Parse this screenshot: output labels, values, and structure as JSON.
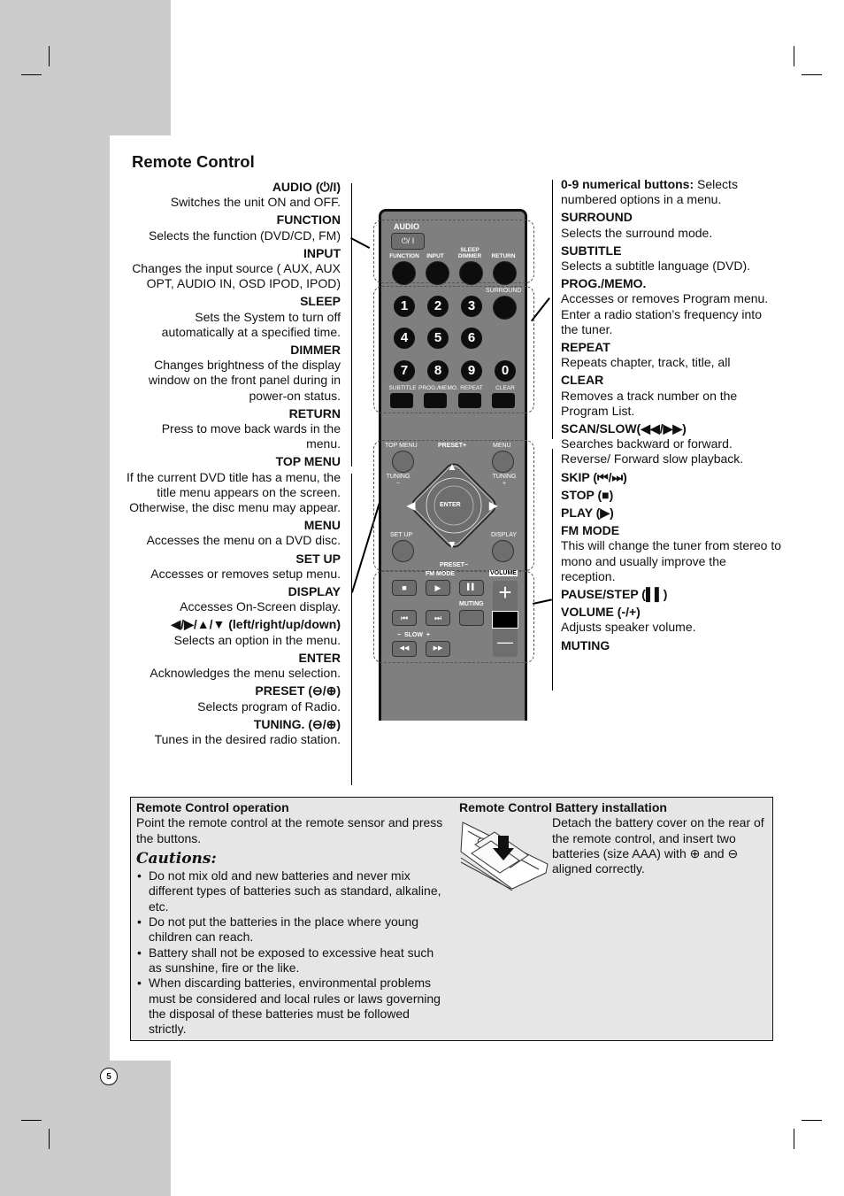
{
  "page": {
    "title": "Remote Control",
    "page_number": "5"
  },
  "left_descriptions": [
    {
      "heading": "AUDIO (⏻/I)",
      "text": "Switches the unit ON and OFF."
    },
    {
      "heading": "FUNCTION",
      "text": "Selects the function (DVD/CD, FM)"
    },
    {
      "heading": "INPUT",
      "text": "Changes the input source ( AUX, AUX OPT, AUDIO IN, OSD IPOD, IPOD)"
    },
    {
      "heading": "SLEEP",
      "text": "Sets the System to turn off automatically at a specified time."
    },
    {
      "heading": "DIMMER",
      "text": "Changes brightness of the display window on the front panel during in power-on status."
    },
    {
      "heading": "RETURN",
      "text": "Press to move back wards in the menu."
    },
    {
      "heading": "TOP MENU",
      "text": "If the current DVD title has a menu, the title menu appears on the screen. Otherwise, the disc menu may appear."
    },
    {
      "heading": "MENU",
      "text": "Accesses the menu on a DVD disc."
    },
    {
      "heading": "SET UP",
      "text": "Accesses or removes setup menu."
    },
    {
      "heading": "DISPLAY",
      "text": "Accesses On-Screen display."
    },
    {
      "heading": "◀/▶/▲/▼ (left/right/up/down)",
      "text": "Selects an option in the menu."
    },
    {
      "heading": "ENTER",
      "text": "Acknowledges the menu selection."
    },
    {
      "heading": "PRESET (⊖/⊕)",
      "text": "Selects program of Radio."
    },
    {
      "heading": "TUNING. (⊖/⊕)",
      "text": "Tunes in the desired radio station."
    }
  ],
  "right_descriptions": [
    {
      "heading": "0-9 numerical buttons:",
      "text": " Selects numbered options in a menu.",
      "inline": true
    },
    {
      "heading": "SURROUND",
      "text": "Selects the surround mode."
    },
    {
      "heading": "SUBTITLE",
      "text": "Selects a subtitle language (DVD)."
    },
    {
      "heading": "PROG./MEMO.",
      "text": "Accesses or removes Program menu.\nEnter a radio station’s frequency into the tuner."
    },
    {
      "heading": "REPEAT",
      "text": "Repeats chapter, track, title, all"
    },
    {
      "heading": "CLEAR",
      "text": "Removes a track number on the Program List."
    },
    {
      "heading": "SCAN/SLOW(◀◀/▶▶)",
      "text": "Searches backward or forward. Reverse/ Forward slow playback."
    },
    {
      "heading": "SKIP (⏮/⏭)",
      "text": ""
    },
    {
      "heading": "STOP (■)",
      "text": ""
    },
    {
      "heading": "PLAY (▶)",
      "text": ""
    },
    {
      "heading": "FM MODE",
      "text": "This will change the tuner from stereo to mono and usually improve the reception."
    },
    {
      "heading": "PAUSE/STEP (▌▌)",
      "text": ""
    },
    {
      "heading": "VOLUME (-/+)",
      "text": "Adjusts speaker volume."
    },
    {
      "heading": "MUTING",
      "text": ""
    }
  ],
  "remote": {
    "audio_label": "AUDIO",
    "power_glyph": "⏻/ I",
    "top_row_labels": [
      "FUNCTION",
      "INPUT",
      "SLEEP DIMMER",
      "RETURN"
    ],
    "surround_label": "SURROUND",
    "digits": [
      "1",
      "2",
      "3",
      "4",
      "5",
      "6",
      "7",
      "8",
      "9",
      "0"
    ],
    "bottom_row_labels": [
      "SUBTITLE",
      "PROG./MEMO.",
      "REPEAT",
      "CLEAR"
    ],
    "top_menu": "TOP MENU",
    "preset_plus": "PRESET+",
    "menu": "MENU",
    "tuning_minus": "TUNING −",
    "tuning_plus": "TUNING +",
    "enter": "ENTER",
    "set_up": "SET UP",
    "display": "DISPLAY",
    "preset_minus": "PRESET−",
    "fm_mode": "FM MODE",
    "volume": "VOLUME",
    "muting": "MUTING",
    "slow": "−  SLOW  +",
    "stop_glyph": "■",
    "play_glyph": "▶",
    "pause_glyph": "▌▌",
    "prev_glyph": "⏮",
    "next_glyph": "⏭",
    "rew_glyph": "◀◀",
    "ff_glyph": "▶▶",
    "vol_plus": "+",
    "vol_minus": "—",
    "up": "▲",
    "down": "▼",
    "left": "◀",
    "right": "▶"
  },
  "info": {
    "operation_heading": "Remote Control operation",
    "operation_text": "Point the remote control at the remote sensor and press the buttons.",
    "cautions_heading": "Cautions:",
    "cautions": [
      "Do not mix old and new batteries and never mix different types of batteries such as standard, alkaline, etc.",
      "Do not put the batteries in the place where young children can reach.",
      "Battery shall not be exposed to excessive heat such as sunshine, fire or the like.",
      "When discarding batteries, environmental problems must be considered and local rules or laws governing the disposal of these batteries must be followed strictly."
    ],
    "battery_heading": "Remote Control Battery installation",
    "battery_text": "Detach the battery cover on the rear of the remote control, and insert two batteries (size AAA) with ⊕ and ⊖ aligned correctly."
  }
}
